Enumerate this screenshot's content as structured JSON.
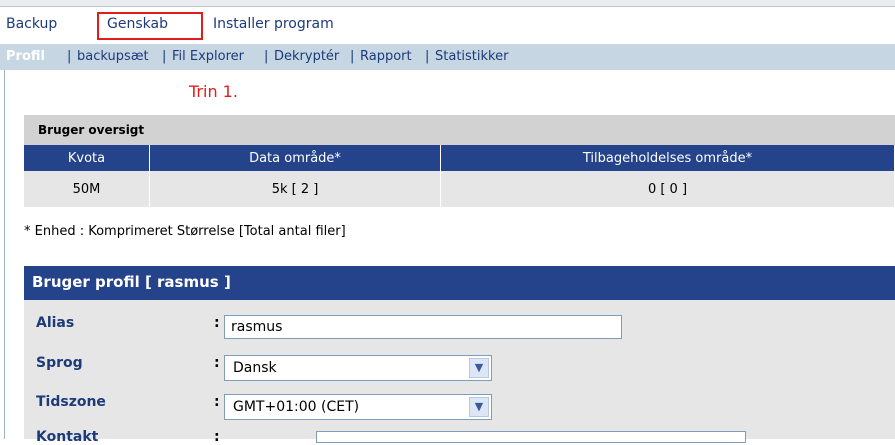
{
  "main_nav": [
    {
      "label": "Backup"
    },
    {
      "label": "Genskab"
    },
    {
      "label": "Installer program"
    }
  ],
  "sub_nav": {
    "active": "Profil",
    "items": [
      "backupsæt",
      "Fil Explorer",
      "Dekryptér",
      "Rapport",
      "Statistikker"
    ]
  },
  "step_label": "Trin 1.",
  "summary": {
    "title": "Bruger oversigt",
    "headers": [
      "Kvota",
      "Data område*",
      "Tilbageholdelses område*"
    ],
    "row": [
      "50M",
      "5k [ 2 ]",
      "0 [ 0 ]"
    ]
  },
  "note": "* Enhed : Komprimeret Størrelse [Total antal filer]",
  "profile": {
    "title": "Bruger profil [ rasmus ]",
    "fields": [
      {
        "label": "Alias",
        "value": "rasmus"
      },
      {
        "label": "Sprog",
        "value": "Dansk"
      },
      {
        "label": "Tidszone",
        "value": "GMT+01:00 (CET)"
      },
      {
        "label": "Kontakt"
      }
    ],
    "colon": ":"
  }
}
